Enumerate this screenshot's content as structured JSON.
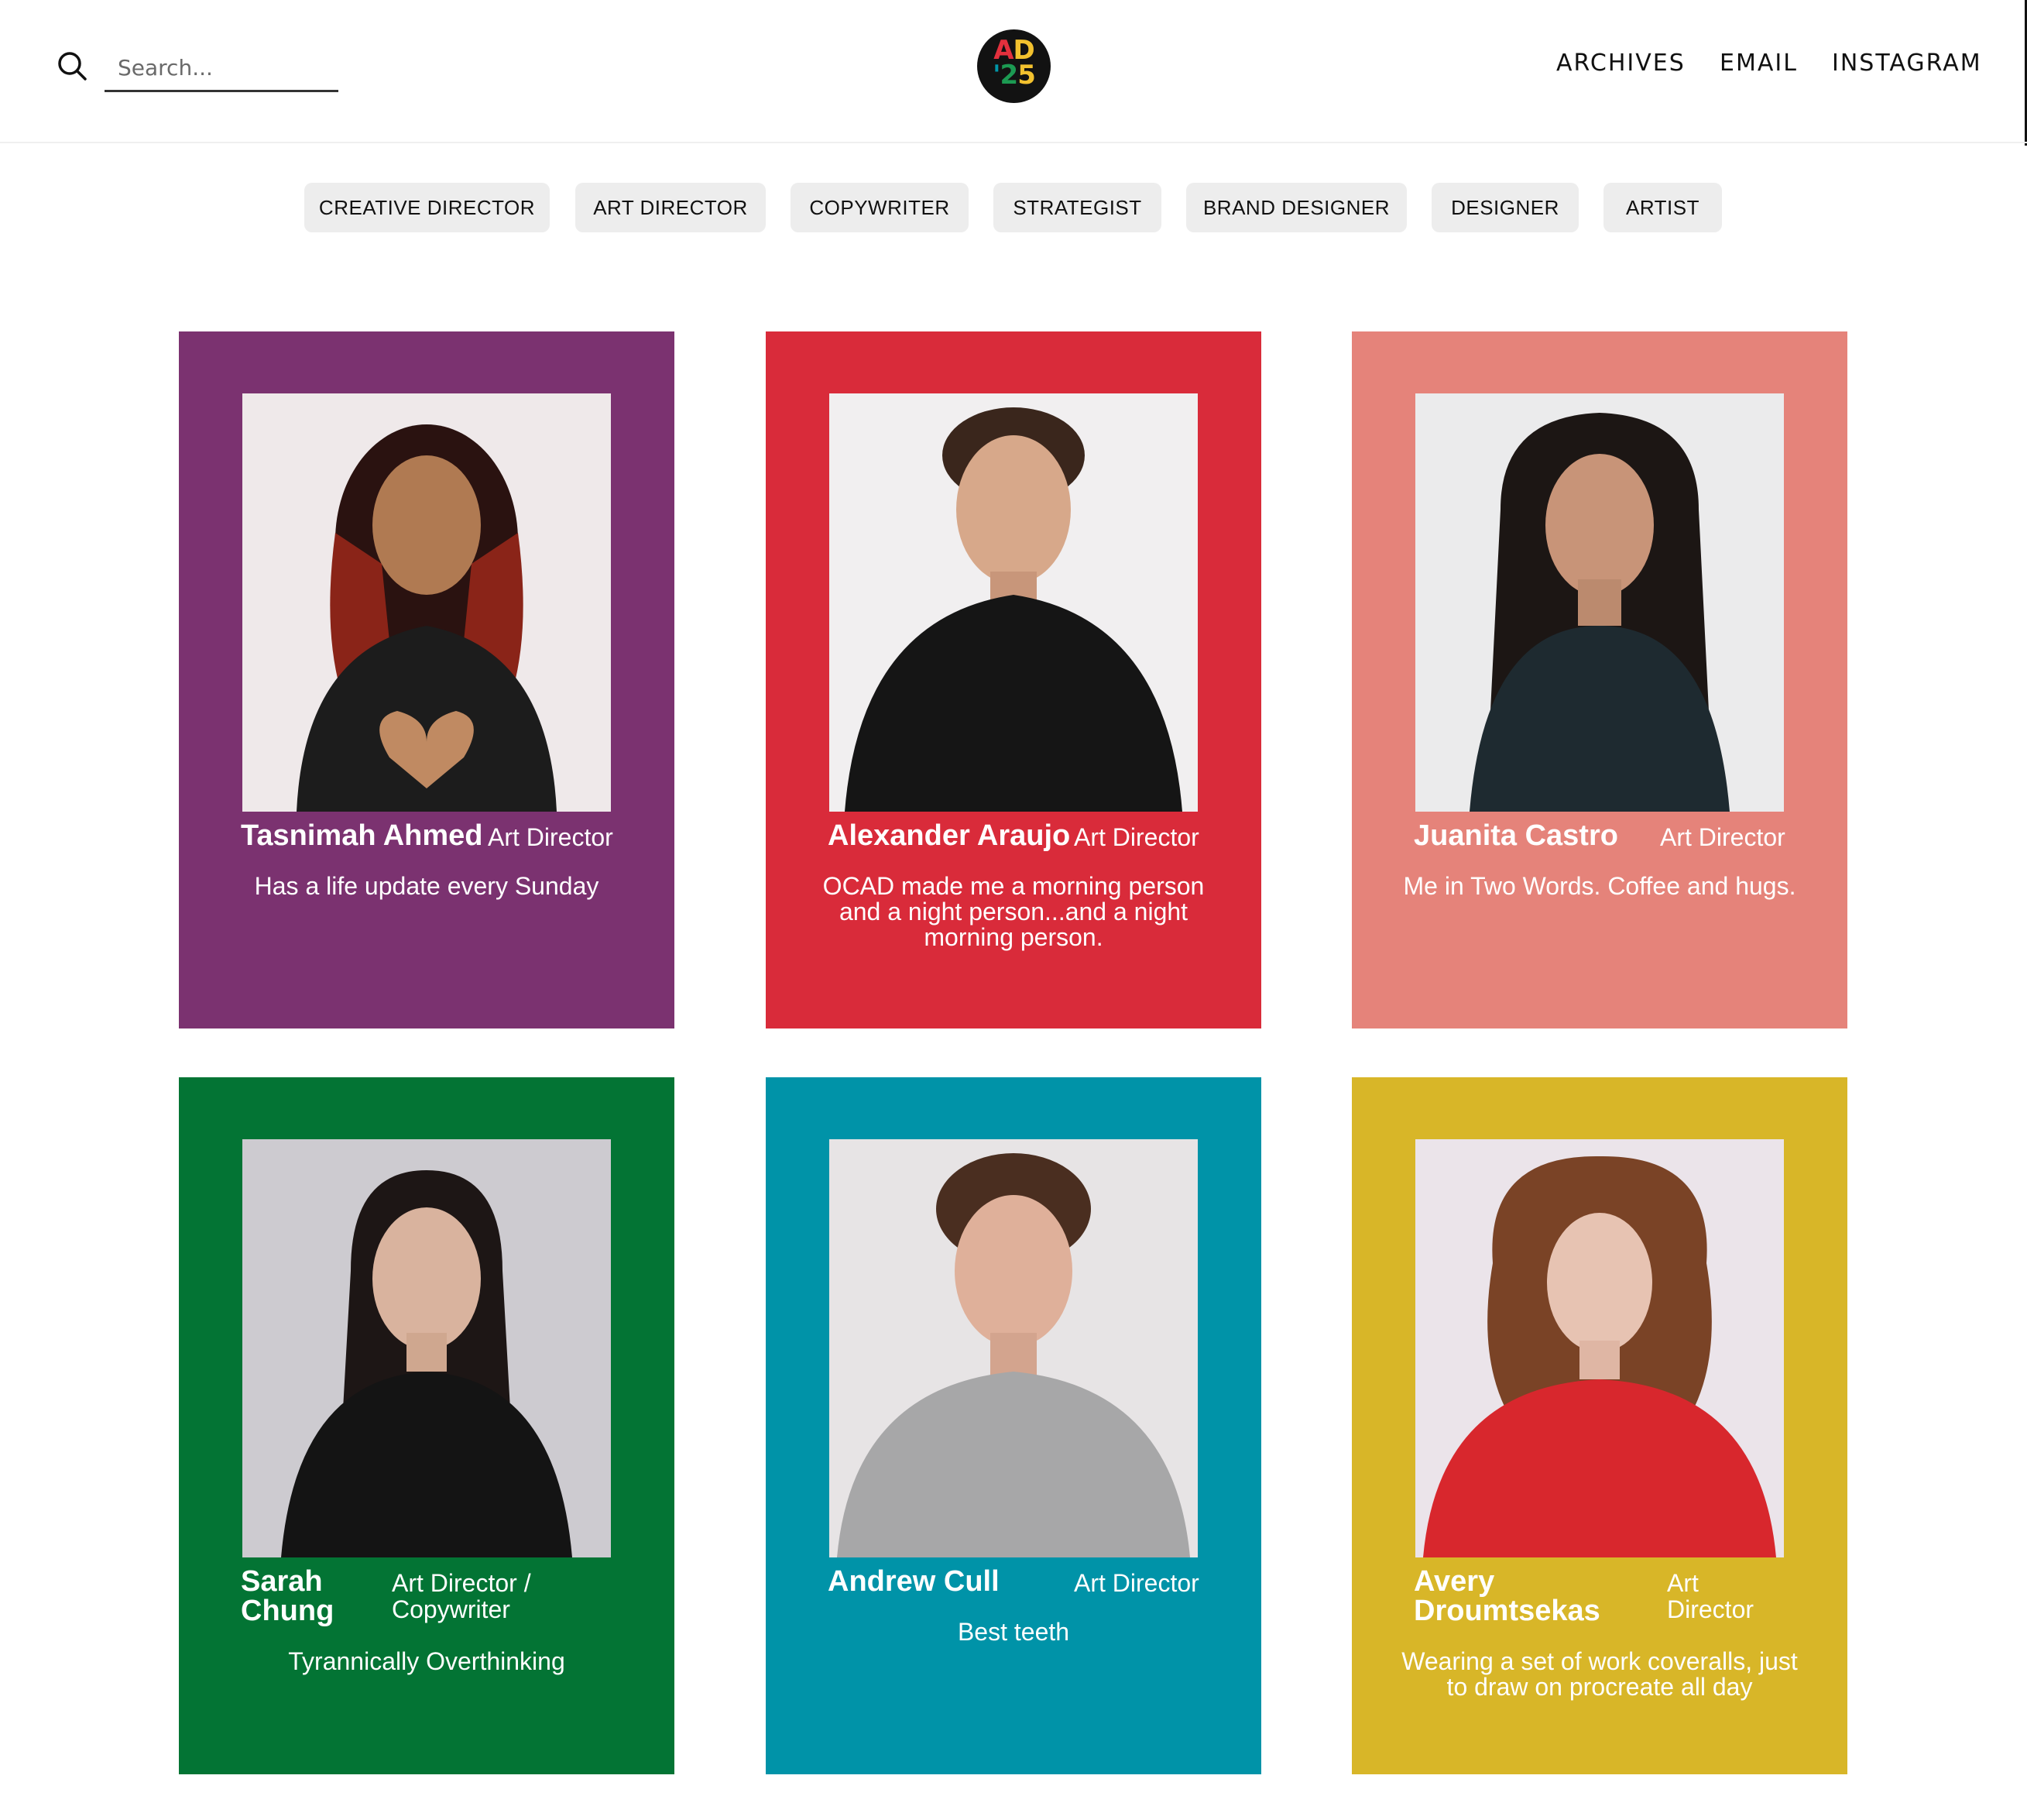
{
  "header": {
    "search_placeholder": "Search...",
    "logo_line1": "AD",
    "logo_line2": "'25",
    "nav": [
      "ARCHIVES",
      "EMAIL",
      "INSTAGRAM"
    ]
  },
  "filters": [
    "CREATIVE DIRECTOR",
    "ART DIRECTOR",
    "COPYWRITER",
    "STRATEGIST",
    "BRAND DESIGNER",
    "DESIGNER",
    "ARTIST"
  ],
  "cards": [
    {
      "name": "Tasnimah Ahmed",
      "role": "Art Director",
      "desc": "Has a life update every Sunday",
      "color": "#7b3270"
    },
    {
      "name": "Alexander Araujo",
      "role": "Art Director",
      "desc": "OCAD made me a morning person and a night person...and a night morning person.",
      "color": "#d92b3a"
    },
    {
      "name": "Juanita Castro",
      "role": "Art Director",
      "desc": "Me in Two Words. Coffee and hugs.",
      "color": "#e5837a"
    },
    {
      "name": "Sarah Chung",
      "role": "Art Director / Copywriter",
      "desc": "Tyrannically Overthinking",
      "color": "#037434"
    },
    {
      "name": "Andrew Cull",
      "role": "Art Director",
      "desc": "Best teeth",
      "color": "#0093a8"
    },
    {
      "name": "Avery Droumtsekas",
      "role": "Art Director",
      "desc": "Wearing a set of work coveralls, just to draw on procreate all day",
      "color": "#d8b628"
    }
  ]
}
